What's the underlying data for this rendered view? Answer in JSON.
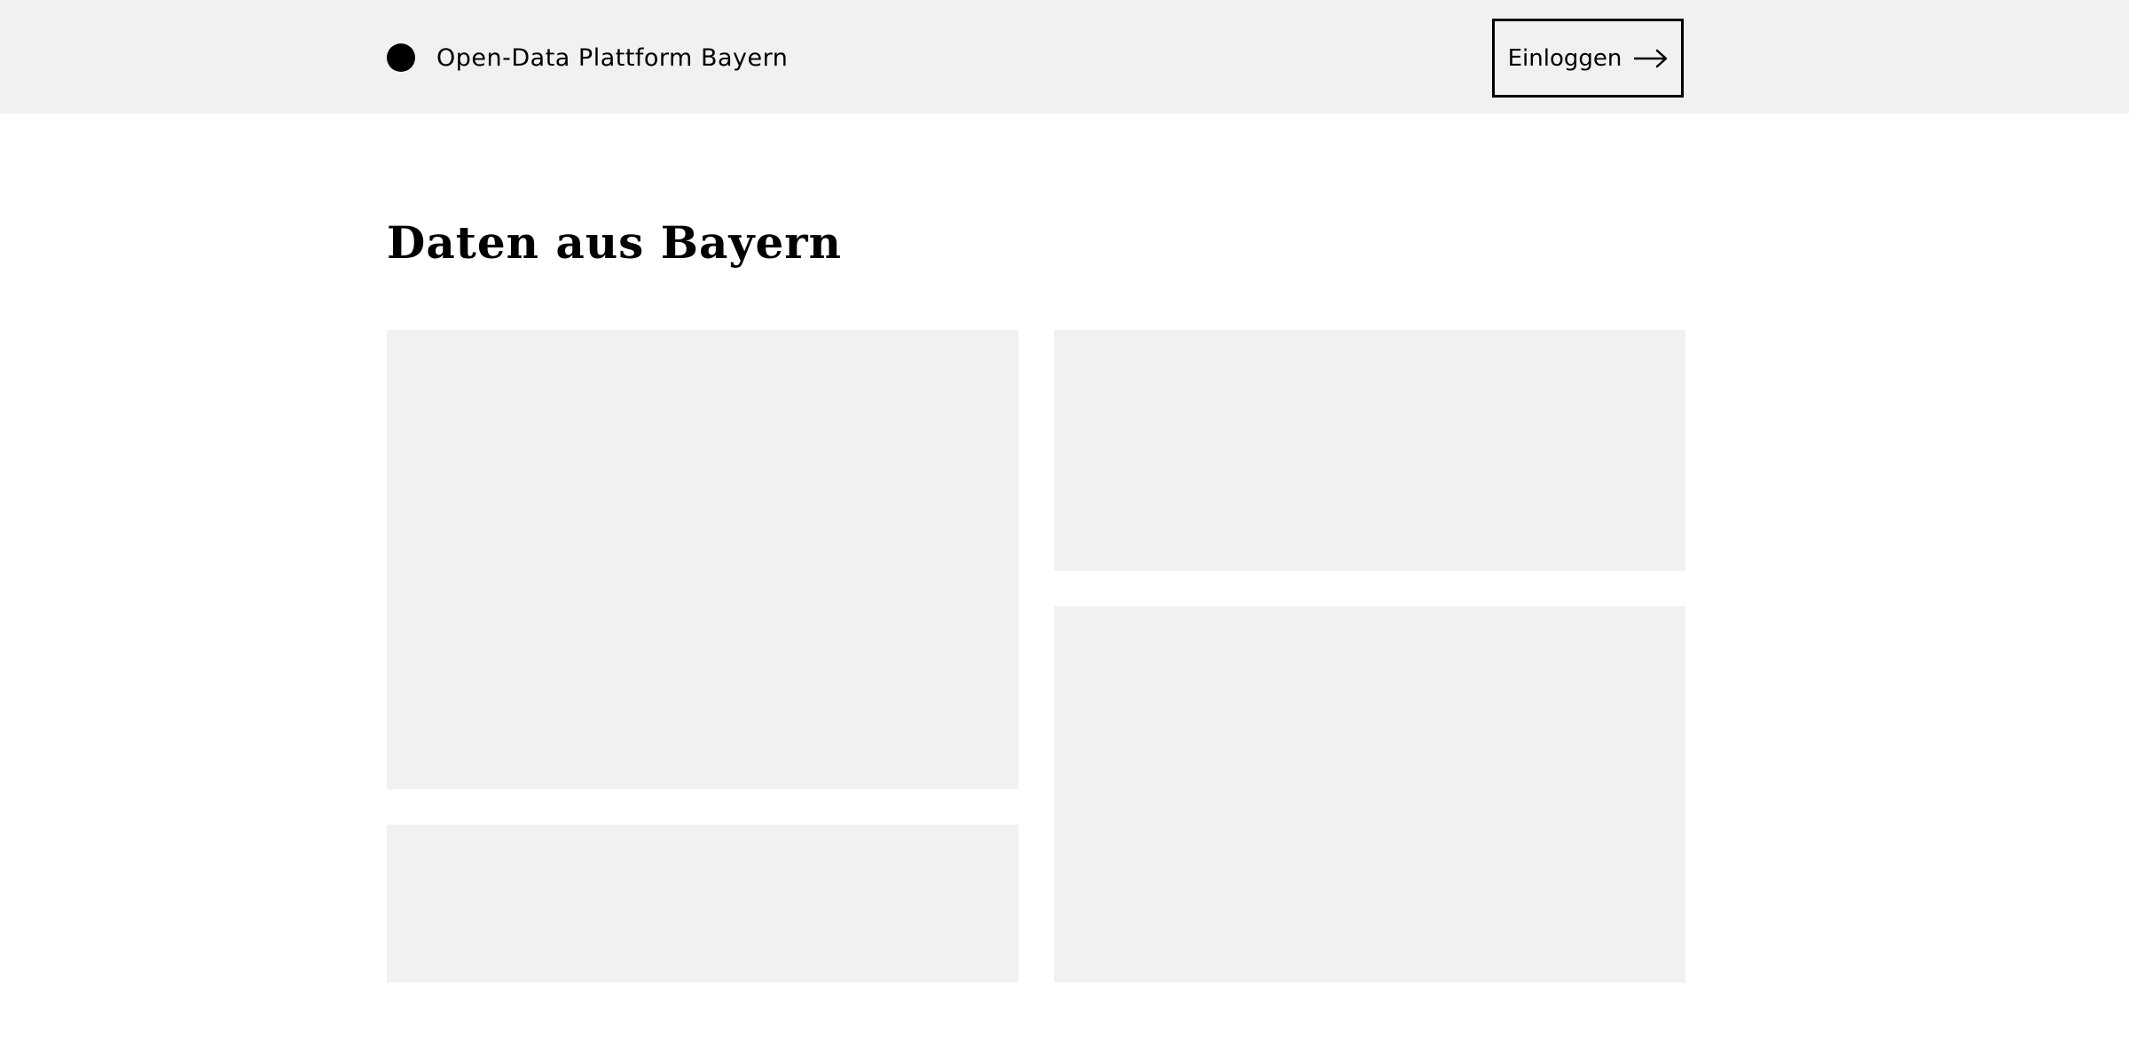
{
  "header": {
    "brand_name": "Open-Data Plattform Bayern",
    "login_label": "Einloggen"
  },
  "main": {
    "title": "Daten aus Bayern"
  },
  "colors": {
    "header_background": "#f1f1f1",
    "card_background": "#f1f1f1",
    "text": "#000000"
  },
  "icons": {
    "brand": "brand-dot-icon",
    "login": "arrow-right-icon"
  }
}
